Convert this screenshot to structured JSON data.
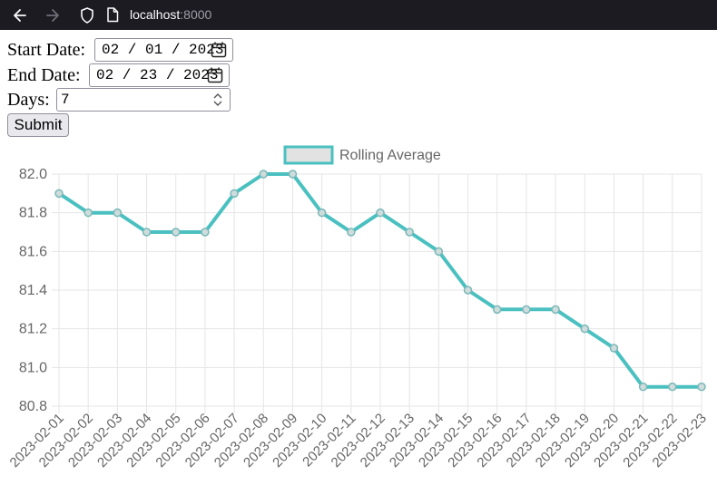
{
  "browser": {
    "url_host": "localhost",
    "url_port": ":8000"
  },
  "form": {
    "start_label": "Start Date:",
    "start_value": "02 / 01 / 2023",
    "end_label": "End Date:",
    "end_value": "02 / 23 / 2023",
    "days_label": "Days:",
    "days_value": "7",
    "submit_label": "Submit"
  },
  "colors": {
    "line": "#4bc0c0",
    "legend_fill": "#e2e2e2",
    "grid": "#e5e5e5"
  },
  "chart_data": {
    "type": "line",
    "title": "",
    "xlabel": "",
    "ylabel": "",
    "categories": [
      "2023-02-01",
      "2023-02-02",
      "2023-02-03",
      "2023-02-04",
      "2023-02-05",
      "2023-02-06",
      "2023-02-07",
      "2023-02-08",
      "2023-02-09",
      "2023-02-10",
      "2023-02-11",
      "2023-02-12",
      "2023-02-13",
      "2023-02-14",
      "2023-02-15",
      "2023-02-16",
      "2023-02-17",
      "2023-02-18",
      "2023-02-19",
      "2023-02-20",
      "2023-02-21",
      "2023-02-22",
      "2023-02-23"
    ],
    "series": [
      {
        "name": "Rolling Average",
        "values": [
          81.9,
          81.8,
          81.8,
          81.7,
          81.7,
          81.7,
          81.9,
          82.0,
          82.0,
          81.8,
          81.7,
          81.8,
          81.7,
          81.6,
          81.4,
          81.3,
          81.3,
          81.3,
          81.2,
          81.1,
          80.9,
          80.9,
          80.9
        ]
      }
    ],
    "ylim": [
      80.8,
      82.0
    ],
    "yticks": [
      "82.0",
      "81.8",
      "81.6",
      "81.4",
      "81.2",
      "81.0",
      "80.8"
    ],
    "grid": true,
    "legend_position": "top"
  }
}
